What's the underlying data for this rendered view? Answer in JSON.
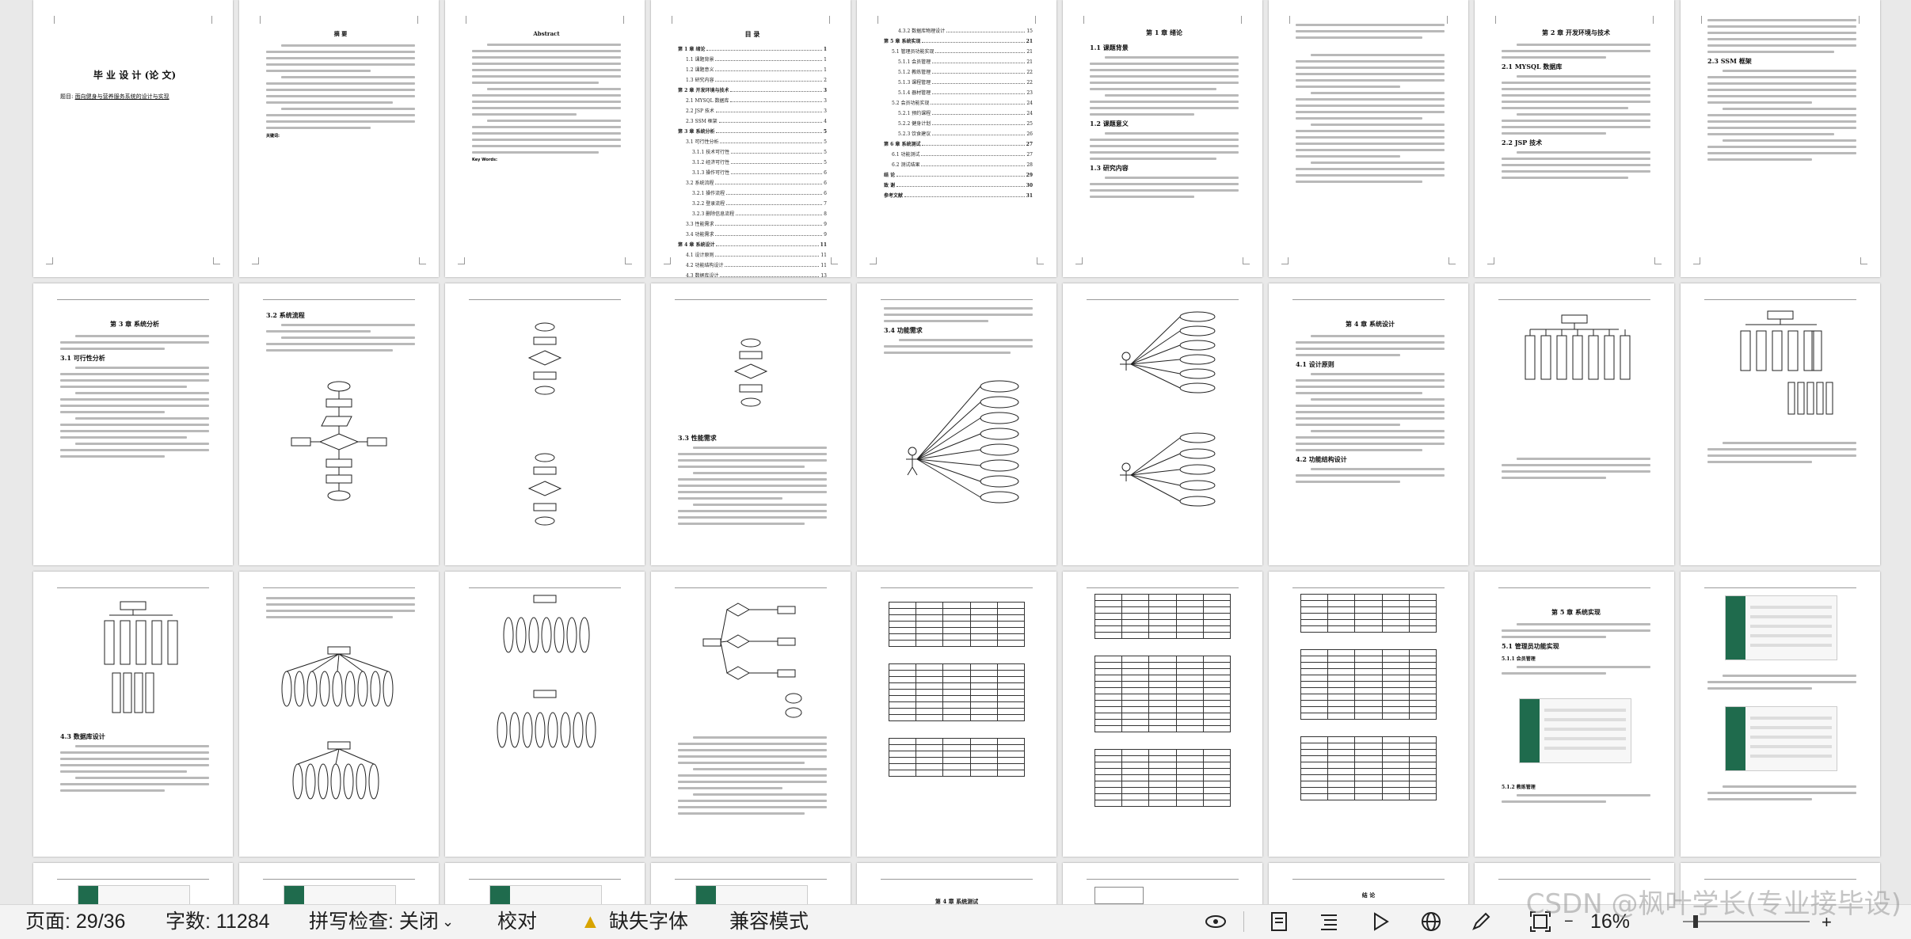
{
  "status": {
    "page": "页面: 29/36",
    "words": "字数: 11284",
    "spell": "拼写检查: 关闭",
    "proof": "校对",
    "missing_font": "缺失字体",
    "compat": "兼容模式",
    "zoom": "16%"
  },
  "watermark": "CSDN @枫叶学长(专业接毕设)",
  "pages": {
    "cover_title": "毕 业 设 计 (论 文)",
    "cover_topic_label": "题目:",
    "cover_topic": "面向健身与营养服务系统的设计与实现",
    "abstract_cn": "摘 要",
    "abstract_cn_keywords": "关键词:",
    "abstract_en": "Abstract",
    "abstract_en_keywords": "Key Words:",
    "toc_title": "目 录",
    "toc": [
      {
        "t": "第 1 章  绪论",
        "p": "1",
        "lvl": 0
      },
      {
        "t": "1.1 课题背景",
        "p": "1",
        "lvl": 1
      },
      {
        "t": "1.2 课题意义",
        "p": "1",
        "lvl": 1
      },
      {
        "t": "1.3 研究内容",
        "p": "2",
        "lvl": 1
      },
      {
        "t": "第 2 章  开发环境与技术",
        "p": "3",
        "lvl": 0
      },
      {
        "t": "2.1 MYSQL 数据库",
        "p": "3",
        "lvl": 1
      },
      {
        "t": "2.2 JSP 技术",
        "p": "3",
        "lvl": 1
      },
      {
        "t": "2.3 SSM 框架",
        "p": "4",
        "lvl": 1
      },
      {
        "t": "第 3 章  系统分析",
        "p": "5",
        "lvl": 0
      },
      {
        "t": "3.1 可行性分析",
        "p": "5",
        "lvl": 1
      },
      {
        "t": "3.1.1 技术可行性",
        "p": "5",
        "lvl": 2
      },
      {
        "t": "3.1.2 经济可行性",
        "p": "5",
        "lvl": 2
      },
      {
        "t": "3.1.3 操作可行性",
        "p": "6",
        "lvl": 2
      },
      {
        "t": "3.2 系统流程",
        "p": "6",
        "lvl": 1
      },
      {
        "t": "3.2.1 操作流程",
        "p": "6",
        "lvl": 2
      },
      {
        "t": "3.2.2 登录流程",
        "p": "7",
        "lvl": 2
      },
      {
        "t": "3.2.3 删除信息流程",
        "p": "8",
        "lvl": 2
      },
      {
        "t": "3.3 性能需求",
        "p": "9",
        "lvl": 1
      },
      {
        "t": "3.4 功能需求",
        "p": "9",
        "lvl": 1
      },
      {
        "t": "第 4 章  系统设计",
        "p": "11",
        "lvl": 0
      },
      {
        "t": "4.1 设计原则",
        "p": "11",
        "lvl": 1
      },
      {
        "t": "4.2 功能结构设计",
        "p": "11",
        "lvl": 1
      },
      {
        "t": "4.3 数据库设计",
        "p": "13",
        "lvl": 1
      },
      {
        "t": "4.3.1 数据库概念设计",
        "p": "14",
        "lvl": 2
      }
    ],
    "toc2": [
      {
        "t": "4.3.2 数据库物理设计",
        "p": "15",
        "lvl": 2
      },
      {
        "t": "第 5 章  系统实现",
        "p": "21",
        "lvl": 0
      },
      {
        "t": "5.1 管理员功能实现",
        "p": "21",
        "lvl": 1
      },
      {
        "t": "5.1.1 会员管理",
        "p": "21",
        "lvl": 2
      },
      {
        "t": "5.1.2 教练管理",
        "p": "22",
        "lvl": 2
      },
      {
        "t": "5.1.3 课程管理",
        "p": "22",
        "lvl": 2
      },
      {
        "t": "5.1.4 器材管理",
        "p": "23",
        "lvl": 2
      },
      {
        "t": "5.2 会员功能实现",
        "p": "24",
        "lvl": 1
      },
      {
        "t": "5.2.1 预约课程",
        "p": "24",
        "lvl": 2
      },
      {
        "t": "5.2.2 健身计划",
        "p": "25",
        "lvl": 2
      },
      {
        "t": "5.2.3 饮食建议",
        "p": "26",
        "lvl": 2
      },
      {
        "t": "第 6 章  系统测试",
        "p": "27",
        "lvl": 0
      },
      {
        "t": "6.1 功能测试",
        "p": "27",
        "lvl": 1
      },
      {
        "t": "6.2 测试结果",
        "p": "28",
        "lvl": 1
      },
      {
        "t": "结 论",
        "p": "29",
        "lvl": 0
      },
      {
        "t": "致 谢",
        "p": "30",
        "lvl": 0
      },
      {
        "t": "参考文献",
        "p": "31",
        "lvl": 0
      }
    ],
    "ch1_title": "第 1 章  绪论",
    "ch2_title": "第 2 章  开发环境与技术",
    "ch3_title": "第 3 章  系统分析",
    "ch4_title": "第 4 章  系统设计",
    "ch5_title": "第 5 章  系统实现",
    "ch6_title": "第 4 章  系统测试",
    "conclusion": "结 论",
    "s_11": "1.1 课题背景",
    "s_12": "1.2 课题意义",
    "s_13": "1.3 研究内容",
    "s_21": "2.1 MYSQL 数据库",
    "s_22": "2.2 JSP 技术",
    "s_23": "2.3 SSM 框架",
    "s_31": "3.1 可行性分析",
    "s_32": "3.2 系统流程",
    "s_33": "3.3 性能需求",
    "s_34": "3.4 功能需求",
    "s_41": "4.1 设计原则",
    "s_42": "4.2 功能结构设计",
    "s_43": "4.3 数据库设计",
    "s_51": "5.1 管理员功能实现",
    "s_511": "5.1.1 会员管理",
    "s_512": "5.1.2 教练管理",
    "pager_label": "页面: 29/36"
  }
}
